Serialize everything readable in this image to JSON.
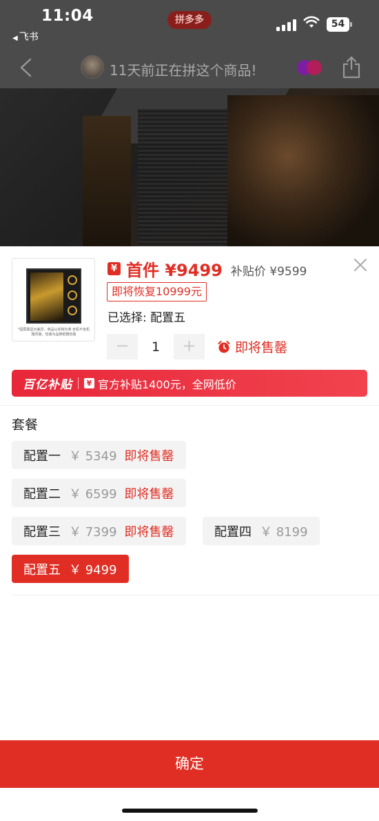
{
  "status_bar": {
    "time": "11:04",
    "back_app": "飞书",
    "brand": "拼多多",
    "battery": "54"
  },
  "nav": {
    "title": "11天前正在拼这个商品!"
  },
  "product": {
    "price_icon": "¥",
    "price_main": "首件 ¥9499",
    "price_sub": "补贴价 ¥9599",
    "restore_tag": "即将恢复10999元",
    "selected": "已选择: 配置五",
    "thumb_note": "*因屏幕显示差异，商品以实物为准 含机不含机箱风扇，包装为品牌纸箱包装",
    "qty_minus": "−",
    "qty_plus": "+",
    "quantity": "1",
    "stock_warning": "即将售罄"
  },
  "banner": {
    "logo": "百亿补贴",
    "icon": "¥",
    "text": "官方补贴1400元，全网低价"
  },
  "section_title": "套餐",
  "options": [
    {
      "name": "配置一",
      "price": "￥ 5349",
      "stock": "即将售罄"
    },
    {
      "name": "配置二",
      "price": "￥ 6599",
      "stock": "即将售罄"
    },
    {
      "name": "配置三",
      "price": "￥ 7399",
      "stock": "即将售罄"
    },
    {
      "name": "配置四",
      "price": "￥ 8199",
      "stock": ""
    },
    {
      "name": "配置五",
      "price": "￥ 9499",
      "stock": ""
    }
  ],
  "selected_option_index": 4,
  "confirm_label": "确定",
  "colors": {
    "accent": "#e02e24",
    "banner": "#ea2f3e",
    "option_bg": "#f3f3f3"
  }
}
